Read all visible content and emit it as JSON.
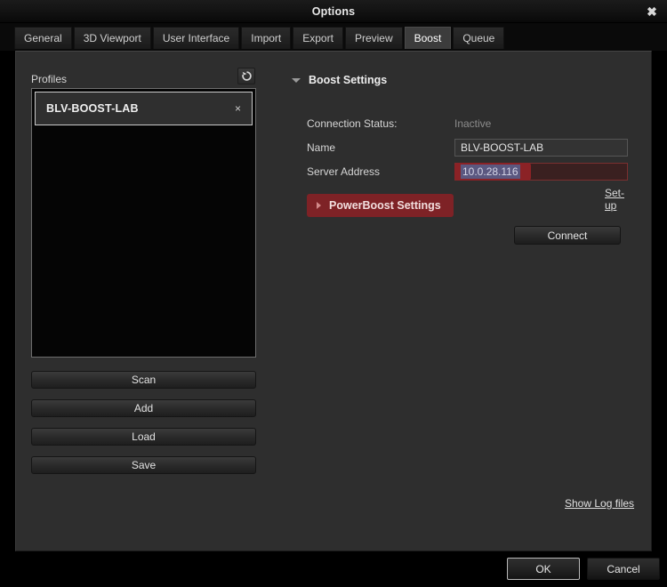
{
  "window": {
    "title": "Options",
    "close_icon": "close-icon",
    "close_glyph": "✖"
  },
  "tabs": [
    {
      "label": "General",
      "active": false
    },
    {
      "label": "3D Viewport",
      "active": false
    },
    {
      "label": "User Interface",
      "active": false
    },
    {
      "label": "Import",
      "active": false
    },
    {
      "label": "Export",
      "active": false
    },
    {
      "label": "Preview",
      "active": false
    },
    {
      "label": "Boost",
      "active": true
    },
    {
      "label": "Queue",
      "active": false
    }
  ],
  "profiles": {
    "label": "Profiles",
    "refresh_icon": "refresh-icon",
    "items": [
      {
        "name": "BLV-BOOST-LAB",
        "selected": true,
        "close_glyph": "×"
      }
    ],
    "buttons": [
      {
        "label": "Scan"
      },
      {
        "label": "Add"
      },
      {
        "label": "Load"
      },
      {
        "label": "Save"
      }
    ]
  },
  "boost_settings": {
    "section_title": "Boost Settings",
    "expanded": true,
    "connection_status_label": "Connection Status:",
    "connection_status_value": "Inactive",
    "name_label": "Name",
    "name_value": "BLV-BOOST-LAB",
    "server_address_label": "Server Address",
    "server_address_value": "10.0.28.116",
    "setup_link": "Set-up",
    "powerboost_label": "PowerBoost Settings",
    "powerboost_expanded": false,
    "connect_label": "Connect"
  },
  "footer": {
    "show_log_link": "Show Log files",
    "ok_label": "OK",
    "cancel_label": "Cancel"
  },
  "colors": {
    "accent_red": "#8b2226",
    "powerboost_red": "#7e2226",
    "panel_bg": "#2e2e2e",
    "window_bg": "#000000",
    "selection_blue": "#5b5880"
  }
}
